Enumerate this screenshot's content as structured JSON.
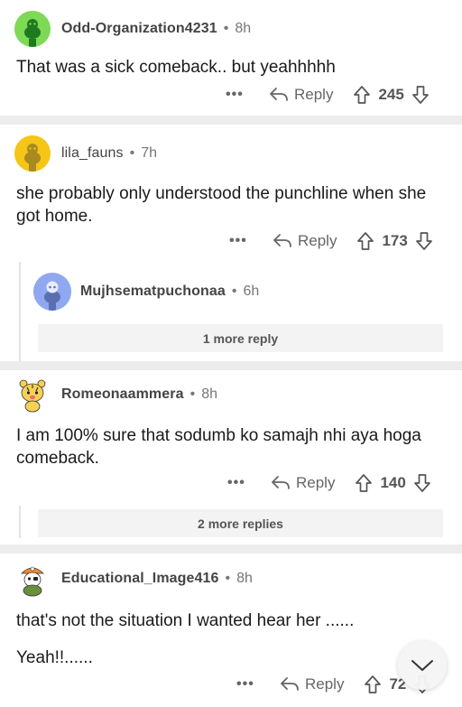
{
  "comments": [
    {
      "username": "Odd-Organization4231",
      "age": "8h",
      "body": "That was a sick comeback.. but yeahhhhh",
      "more": "•••",
      "reply_label": "Reply",
      "votes": "245",
      "avatar_color": "#7ed957"
    },
    {
      "username": "lila_fauns",
      "age": "7h",
      "body": "she probably only understood the punchline when she got home.",
      "more": "•••",
      "reply_label": "Reply",
      "votes": "173",
      "avatar_color": "#f5c518",
      "nested": {
        "username": "Mujhsematpuchonaa",
        "age": "6h",
        "avatar_color": "#8fa8f0",
        "more_replies": "1 more reply"
      }
    },
    {
      "username": "Romeonaammera",
      "age": "8h",
      "body": "I am 100% sure that sodumb ko samajh nhi aya hoga comeback.",
      "more": "•••",
      "reply_label": "Reply",
      "votes": "140",
      "avatar_color": "#f7d154",
      "more_replies": "2 more replies"
    },
    {
      "username": "Educational_Image416",
      "age": "8h",
      "body_line1": "that's not the situation I wanted hear her ......",
      "body_line2": "Yeah!!......",
      "more": "•••",
      "reply_label": "Reply",
      "votes": "72",
      "avatar_color": "#f28c28"
    }
  ],
  "dot": "•",
  "icons": {
    "upvote": "upvote-arrow-icon",
    "downvote": "downvote-arrow-icon",
    "reply": "reply-arrow-icon",
    "scroll": "chevron-down-icon"
  }
}
